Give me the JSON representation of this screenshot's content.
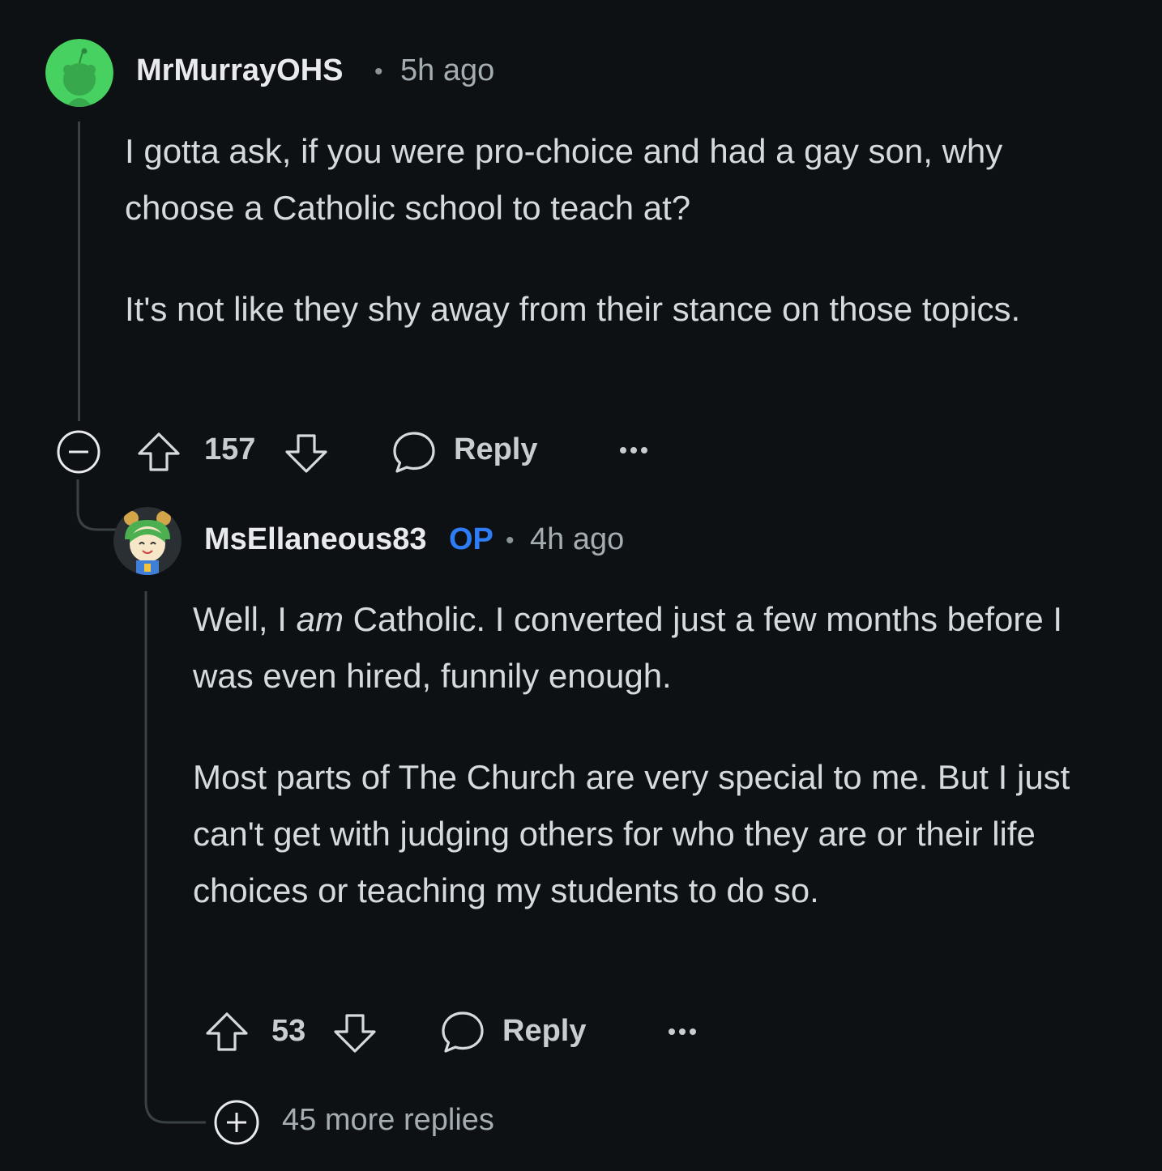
{
  "comment": {
    "author": "MrMurrayOHS",
    "separator": "•",
    "time": "5h ago",
    "paragraph1": "I gotta ask, if you were pro-choice and had a gay son, why choose a Catholic school to teach at?",
    "paragraph2": "It's not like they shy away from their stance on those topics.",
    "score": "157",
    "reply_label": "Reply"
  },
  "reply": {
    "author": "MsEllaneous83",
    "op_badge": "OP",
    "separator": "•",
    "time": "4h ago",
    "p1_before": "Well, I ",
    "p1_em": "am",
    "p1_after": " Catholic. I converted just a few months before I was even hired, funnily enough.",
    "paragraph2": "Most parts of The Church are very special to me. But I just can't get with judging others for who they are or their life choices or teaching my students to do so.",
    "score": "53",
    "reply_label": "Reply"
  },
  "more_replies": "45 more replies",
  "icons": {
    "collapse": "minus-circle-icon",
    "expand": "plus-circle-icon",
    "upvote": "arrow-up-icon",
    "downvote": "arrow-down-icon",
    "reply": "speech-bubble-icon",
    "more": "ellipsis-icon"
  },
  "colors": {
    "background": "#0e1113",
    "op": "#2e7cf6",
    "avatar_green": "#46d160"
  }
}
